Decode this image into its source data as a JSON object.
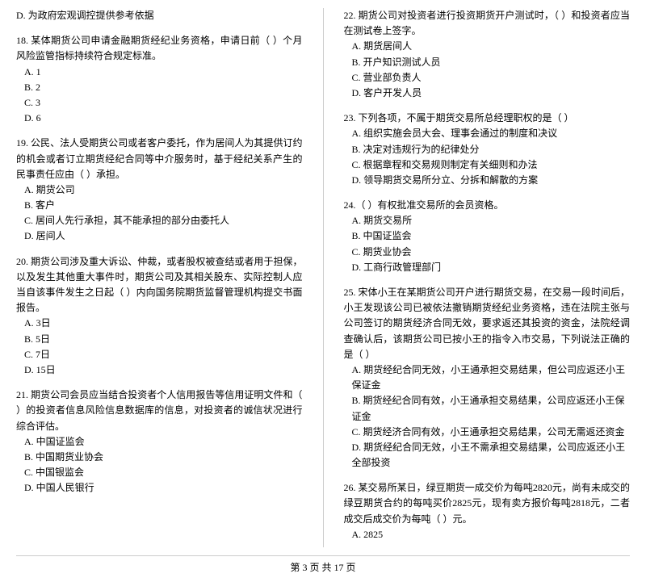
{
  "page": {
    "footer": "第 3 页 共 17 页"
  },
  "left_column": {
    "questions": [
      {
        "id": "q_d",
        "title": "D. 为政府宏观调控提供参考依据"
      },
      {
        "id": "q18",
        "number": "18.",
        "title": "某体期货公司申请金融期货经纪业务资格，申请日前（    ）个月风险监管指标持续符合规定标准。",
        "options": [
          {
            "label": "A. 1"
          },
          {
            "label": "B. 2"
          },
          {
            "label": "C. 3"
          },
          {
            "label": "D. 6"
          }
        ]
      },
      {
        "id": "q19",
        "number": "19.",
        "title": "公民、法人受期货公司或者客户委托，作为居间人为其提供订约的机会或者订立期货经纪合同等中介服务时，基于经纪关系产生的民事责任应由（    ）承担。",
        "options": [
          {
            "label": "A. 期货公司"
          },
          {
            "label": "B. 客户"
          },
          {
            "label": "C. 居间人先行承担，其不能承担的部分由委托人"
          },
          {
            "label": "D. 居间人"
          }
        ]
      },
      {
        "id": "q20",
        "number": "20.",
        "title": "期货公司涉及重大诉讼、仲裁，或者股权被查结或者用于担保，以及发生其他重大事件时，期货公司及其相关股东、实际控制人应当自该事件发生之日起（    ）内向国务院期货监督管理机构提交书面报告。",
        "options": [
          {
            "label": "A. 3日"
          },
          {
            "label": "B. 5日"
          },
          {
            "label": "C. 7日"
          },
          {
            "label": "D. 15日"
          }
        ]
      },
      {
        "id": "q21",
        "number": "21.",
        "title": "期货公司会员应当结合投资者个人信用报告等信用证明文件和（    ）的投资者信息风险信息数据库的信息，对投资者的诚信状况进行综合评估。",
        "options": [
          {
            "label": "A. 中国证监会"
          },
          {
            "label": "B. 中国期货业协会"
          },
          {
            "label": "C. 中国银监会"
          },
          {
            "label": "D. 中国人民银行"
          }
        ]
      }
    ]
  },
  "right_column": {
    "questions": [
      {
        "id": "q22",
        "number": "22.",
        "title": "期货公司对投资者进行投资期货开户测试时，（    ）和投资者应当在测试卷上签字。",
        "options": [
          {
            "label": "A. 期货居间人"
          },
          {
            "label": "B. 开户知识测试人员"
          },
          {
            "label": "C. 营业部负责人"
          },
          {
            "label": "D. 客户开发人员"
          }
        ]
      },
      {
        "id": "q23",
        "number": "23.",
        "title": "下列各项，不属于期货交易所总经理职权的是（    ）",
        "options": [
          {
            "label": "A. 组织实施会员大会、理事会通过的制度和决议"
          },
          {
            "label": "B. 决定对违规行为的纪律处分"
          },
          {
            "label": "C. 根据章程和交易规则制定有关细则和办法"
          },
          {
            "label": "D. 领导期货交易所分立、分拆和解散的方案"
          }
        ]
      },
      {
        "id": "q24",
        "number": "24.（    ）有权批准交易所的会员资格。",
        "title": "（    ）有权批准交易所的会员资格。",
        "options": [
          {
            "label": "A. 期货交易所"
          },
          {
            "label": "B. 中国证监会"
          },
          {
            "label": "C. 期货业协会"
          },
          {
            "label": "D. 工商行政管理部门"
          }
        ]
      },
      {
        "id": "q25",
        "number": "25.",
        "title": "宋体小王在某期货公司开户进行期货交易，在交易一段时间后，小王发现该公司已被依法撤销期货经纪业务资格，违在法院主张与公司签订的期货经济合同无效，要求返还其投资的资金，法院经调查确认后，该期货公司已按小王的指令入市交易，下列说法正确的是（    ）",
        "options": [
          {
            "label": "A. 期货经纪合同无效，小王通承担交易结果，但公司应返还小王保证金"
          },
          {
            "label": "B. 期货经纪合同有效，小王通承担交易结果，公司应返还小王保证金"
          },
          {
            "label": "C. 期货经济合同有效，小王通承担交易结果，公司无需返还资金"
          },
          {
            "label": "D. 期货经纪合同无效，小王不需承担交易结果，公司应返还小王全部投资"
          }
        ]
      },
      {
        "id": "q26",
        "number": "26.",
        "title": "某交易所某日，绿豆期货一成交价为每吨2820元，尚有未成交的绿豆期货合约的每吨买价2825元，现有卖方报价每吨2818元，二者成交后成交价为每吨（    ）元。",
        "options": [
          {
            "label": "A. 2825"
          }
        ]
      }
    ]
  }
}
